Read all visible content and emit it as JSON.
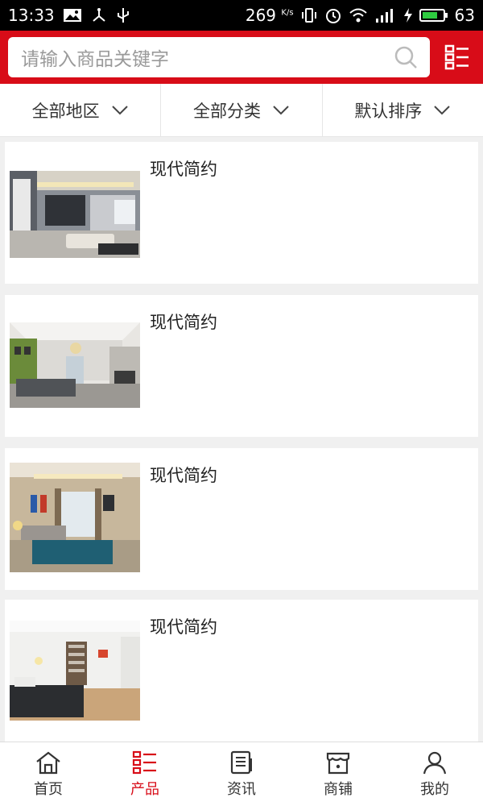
{
  "status_bar": {
    "time": "13:33",
    "net_speed": "269",
    "net_speed_unit": "K/s",
    "battery": "63"
  },
  "search": {
    "placeholder": "请输入商品关键字"
  },
  "filters": [
    {
      "label": "全部地区"
    },
    {
      "label": "全部分类"
    },
    {
      "label": "默认排序"
    }
  ],
  "products": [
    {
      "title": "现代简约"
    },
    {
      "title": "现代简约"
    },
    {
      "title": "现代简约"
    },
    {
      "title": "现代简约"
    }
  ],
  "tabs": [
    {
      "label": "首页",
      "icon": "home-icon"
    },
    {
      "label": "产品",
      "icon": "list-icon",
      "active": true
    },
    {
      "label": "资讯",
      "icon": "news-icon"
    },
    {
      "label": "商铺",
      "icon": "shop-icon"
    },
    {
      "label": "我的",
      "icon": "user-icon"
    }
  ],
  "colors": {
    "brand": "#d80c18"
  }
}
